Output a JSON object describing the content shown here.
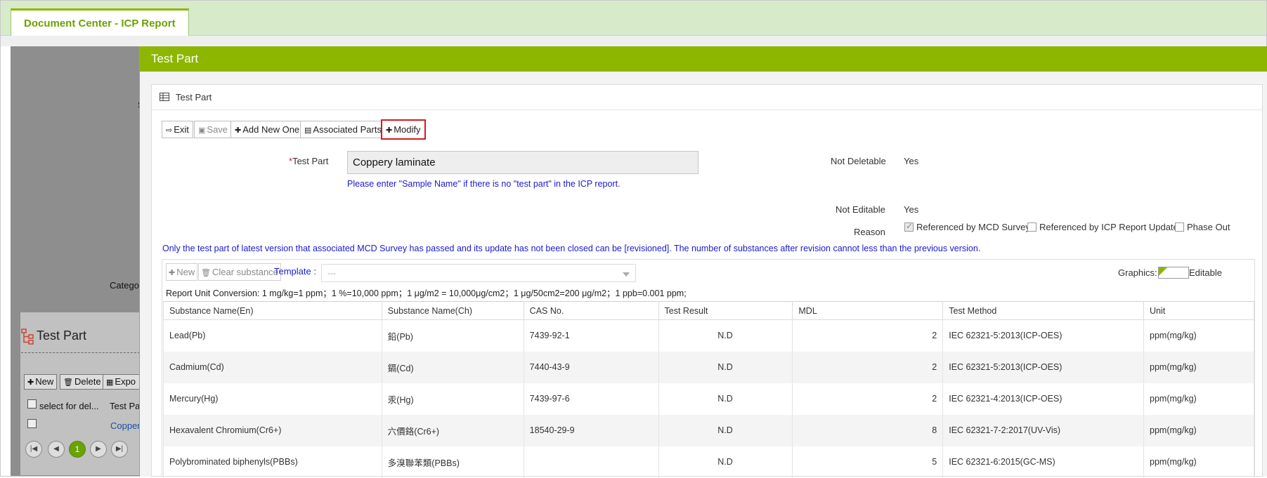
{
  "header": {
    "tab_label": "Document Center - ICP Report"
  },
  "background": {
    "panel_title": "Test Part",
    "side_label_s": "S",
    "side_label_category": "Categor",
    "buttons": {
      "new": "New",
      "delete": "Delete",
      "export": "Expo"
    },
    "columns": {
      "select": "select for del...",
      "test_part": "Test Pa"
    },
    "row_link": "Copper",
    "pager": {
      "current": "1"
    }
  },
  "modal": {
    "title": "Test Part",
    "panel_title": "Test Part",
    "toolbar": {
      "exit": "Exit",
      "save": "Save",
      "add_new": "Add New One",
      "associated": "Associated Parts",
      "modify": "Modify"
    },
    "form": {
      "required_mark": "*",
      "test_part_label": "Test Part",
      "test_part_value": "Coppery laminate",
      "hint": "Please enter \"Sample Name\" if there is no \"test part\" in the ICP report.",
      "not_deletable_label": "Not Deletable",
      "not_deletable_value": "Yes",
      "not_editable_label": "Not Editable",
      "not_editable_value": "Yes",
      "reason_label": "Reason",
      "reason_options": [
        {
          "label": "Referenced by MCD Survey",
          "checked": true
        },
        {
          "label": "Referenced by ICP Report Update",
          "checked": false
        },
        {
          "label": "Phase Out",
          "checked": false
        }
      ]
    },
    "notice": "Only the test part of latest version that associated MCD Survey has passed and its update has not been closed can be [revisioned]. The number of substances after revision cannot less than the previous version.",
    "substances": {
      "new_label": "New",
      "clear_label": "Clear substance",
      "template_label": "Template :",
      "template_value": "---",
      "graphics_label": "Graphics:",
      "editable_label": "Editable",
      "unit_conversion": "Report Unit Conversion: 1 mg/kg=1 ppm；1 %=10,000 ppm；1 μg/m2 = 10,000μg/cm2；1 μg/50cm2=200 μg/m2；1 ppb=0.001 ppm;",
      "columns": [
        "Substance Name(En)",
        "Substance Name(Ch)",
        "CAS No.",
        "Test Result",
        "MDL",
        "Test Method",
        "Unit"
      ],
      "rows": [
        {
          "en": "Lead(Pb)",
          "ch": "鉛(Pb)",
          "cas": "7439-92-1",
          "result": "N.D",
          "mdl": "2",
          "method": "IEC 62321-5:2013(ICP-OES)",
          "unit": "ppm(mg/kg)"
        },
        {
          "en": "Cadmium(Cd)",
          "ch": "鎘(Cd)",
          "cas": "7440-43-9",
          "result": "N.D",
          "mdl": "2",
          "method": "IEC 62321-5:2013(ICP-OES)",
          "unit": "ppm(mg/kg)"
        },
        {
          "en": "Mercury(Hg)",
          "ch": "汞(Hg)",
          "cas": "7439-97-6",
          "result": "N.D",
          "mdl": "2",
          "method": "IEC 62321-4:2013(ICP-OES)",
          "unit": "ppm(mg/kg)"
        },
        {
          "en": "Hexavalent Chromium(Cr6+)",
          "ch": "六價鉻(Cr6+)",
          "cas": "18540-29-9",
          "result": "N.D",
          "mdl": "8",
          "method": "IEC 62321-7-2:2017(UV-Vis)",
          "unit": "ppm(mg/kg)"
        },
        {
          "en": "Polybrominated biphenyls(PBBs)",
          "ch": "多溴聯苯類(PBBs)",
          "cas": "",
          "result": "N.D",
          "mdl": "5",
          "method": "IEC 62321-6:2015(GC-MS)",
          "unit": "ppm(mg/kg)"
        }
      ]
    }
  },
  "colors": {
    "accent": "#8db600",
    "hint_blue": "#1a1ad0",
    "highlight_red": "#d01c1c"
  }
}
